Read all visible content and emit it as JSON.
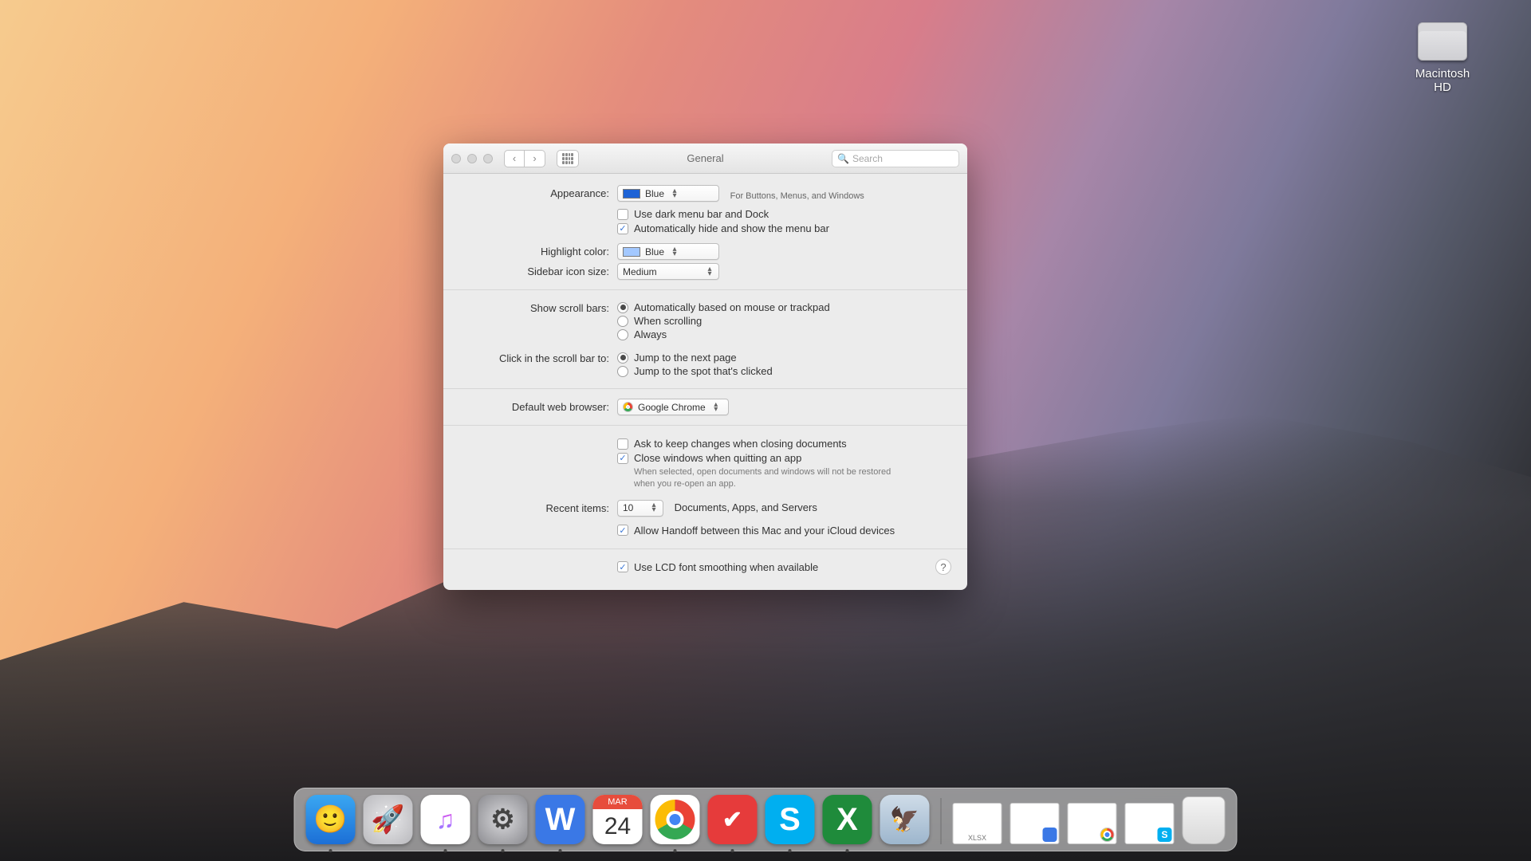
{
  "desktop": {
    "drive_label": "Macintosh HD"
  },
  "window": {
    "title": "General",
    "search_placeholder": "Search",
    "labels": {
      "appearance": "Appearance:",
      "appearance_hint": "For Buttons, Menus, and Windows",
      "highlight": "Highlight color:",
      "sidebar": "Sidebar icon size:",
      "scrollbars": "Show scroll bars:",
      "scrollclick": "Click in the scroll bar to:",
      "browser": "Default web browser:",
      "recent": "Recent items:",
      "recent_hint": "Documents, Apps, and Servers"
    },
    "values": {
      "appearance": "Blue",
      "highlight": "Blue",
      "sidebar": "Medium",
      "browser": "Google Chrome",
      "recent": "10"
    },
    "checkboxes": {
      "dark_menu": "Use dark menu bar and Dock",
      "auto_hide": "Automatically hide and show the menu bar",
      "ask_keep": "Ask to keep changes when closing documents",
      "close_windows": "Close windows when quitting an app",
      "close_windows_hint": "When selected, open documents and windows will not be restored when you re-open an app.",
      "handoff": "Allow Handoff between this Mac and your iCloud devices",
      "lcd": "Use LCD font smoothing when available"
    },
    "radios": {
      "scroll_auto": "Automatically based on mouse or trackpad",
      "scroll_when": "When scrolling",
      "scroll_always": "Always",
      "click_next": "Jump to the next page",
      "click_spot": "Jump to the spot that's clicked"
    }
  },
  "dock": {
    "calendar_month": "MAR",
    "calendar_day": "24",
    "thumb1_label": "XLSX"
  }
}
